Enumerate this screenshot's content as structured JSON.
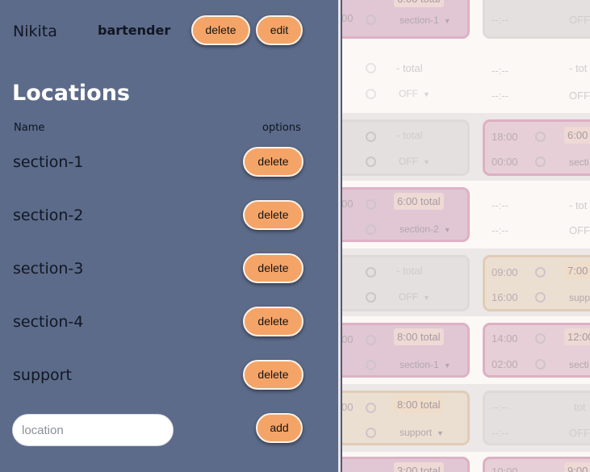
{
  "employee": {
    "name": "Nikita",
    "role": "bartender",
    "delete_label": "delete",
    "edit_label": "edit"
  },
  "locations": {
    "heading": "Locations",
    "col_name": "Name",
    "col_options": "options",
    "items": [
      {
        "name": "section-1",
        "delete_label": "delete"
      },
      {
        "name": "section-2",
        "delete_label": "delete"
      },
      {
        "name": "section-3",
        "delete_label": "delete"
      },
      {
        "name": "section-4",
        "delete_label": "delete"
      },
      {
        "name": "support",
        "delete_label": "delete"
      }
    ],
    "new_location": {
      "value": "",
      "placeholder": "location"
    },
    "add_label": "add"
  },
  "schedule_background": {
    "row1": {
      "left_total": "6:00 total",
      "left_time": "00",
      "left_section": "section-1",
      "right_time": "--:--",
      "right_section": "OFF"
    },
    "row2": {
      "left_total": "- total",
      "left_section": "OFF",
      "right_time_a": "--:--",
      "right_time_b": "--:--",
      "right_total": "- tot",
      "right_section": "OFF"
    },
    "row3": {
      "left_total": "- total",
      "left_section": "OFF",
      "right_start": "18:00",
      "right_end": "00:00",
      "right_total": "6:00",
      "right_section": "secti"
    },
    "row4": {
      "left_total": "6:00 total",
      "left_time": "00",
      "left_section": "section-2",
      "right_time_a": "--:--",
      "right_time_b": "--:--",
      "right_total": "- tot",
      "right_section": "OFF"
    },
    "row5": {
      "left_total": "- total",
      "left_section": "OFF",
      "right_start": "09:00",
      "right_end": "16:00",
      "right_total": "7:00",
      "right_section": "supp"
    },
    "row6": {
      "left_total": "8:00 total",
      "left_time": "00",
      "left_section": "section-1",
      "right_start": "14:00",
      "right_end": "02:00",
      "right_total": "12:00",
      "right_section": "secti"
    },
    "row7": {
      "left_total": "8:00 total",
      "left_time": "00",
      "left_section": "support",
      "right_time_a": "--:--",
      "right_time_b": "--:--",
      "right_total": "tot",
      "right_section": "OFF"
    },
    "row8": {
      "left_total": "3:00 total",
      "right_start": "10:00",
      "right_total": "9:00"
    }
  },
  "colors": {
    "sidebar_bg": "#5c6b8a",
    "button_orange": "#f5a468",
    "heading_white": "#ffffff"
  }
}
